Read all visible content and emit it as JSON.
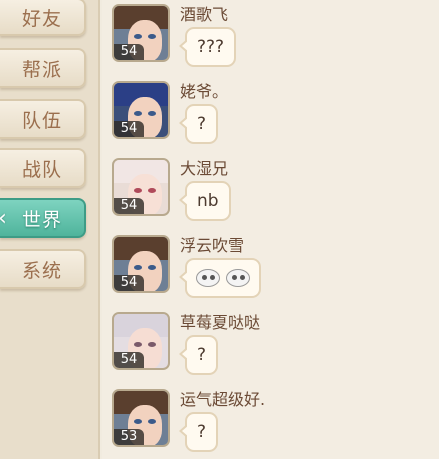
{
  "tabs": [
    {
      "label": "好友",
      "active": false
    },
    {
      "label": "帮派",
      "active": false
    },
    {
      "label": "队伍",
      "active": false
    },
    {
      "label": "战队",
      "active": false
    },
    {
      "label": "世界",
      "active": true
    },
    {
      "label": "系统",
      "active": false
    }
  ],
  "messages": [
    {
      "name": "酒歌飞",
      "level": "54",
      "text": "???",
      "avatar": "male-brown-hair"
    },
    {
      "name": "姥爷。",
      "level": "54",
      "text": "?",
      "avatar": "male-blue-hair"
    },
    {
      "name": "大湿兄",
      "level": "54",
      "text": "nb",
      "avatar": "female-white-hair"
    },
    {
      "name": "浮云吹雪",
      "level": "54",
      "text": "",
      "emoji": "two-white-faces-emoji",
      "avatar": "male-brown-hair"
    },
    {
      "name": "草莓夏哒哒",
      "level": "54",
      "text": "?",
      "avatar": "female-silver-hair"
    },
    {
      "name": "运气超级好.",
      "level": "53",
      "text": "?",
      "avatar": "male-brown-hair"
    }
  ],
  "colors": {
    "active_tab": "#5fc1aa",
    "tab_text": "#9b6f4e",
    "name_text": "#6b4a35",
    "panel_bg": "#f3ede2"
  }
}
